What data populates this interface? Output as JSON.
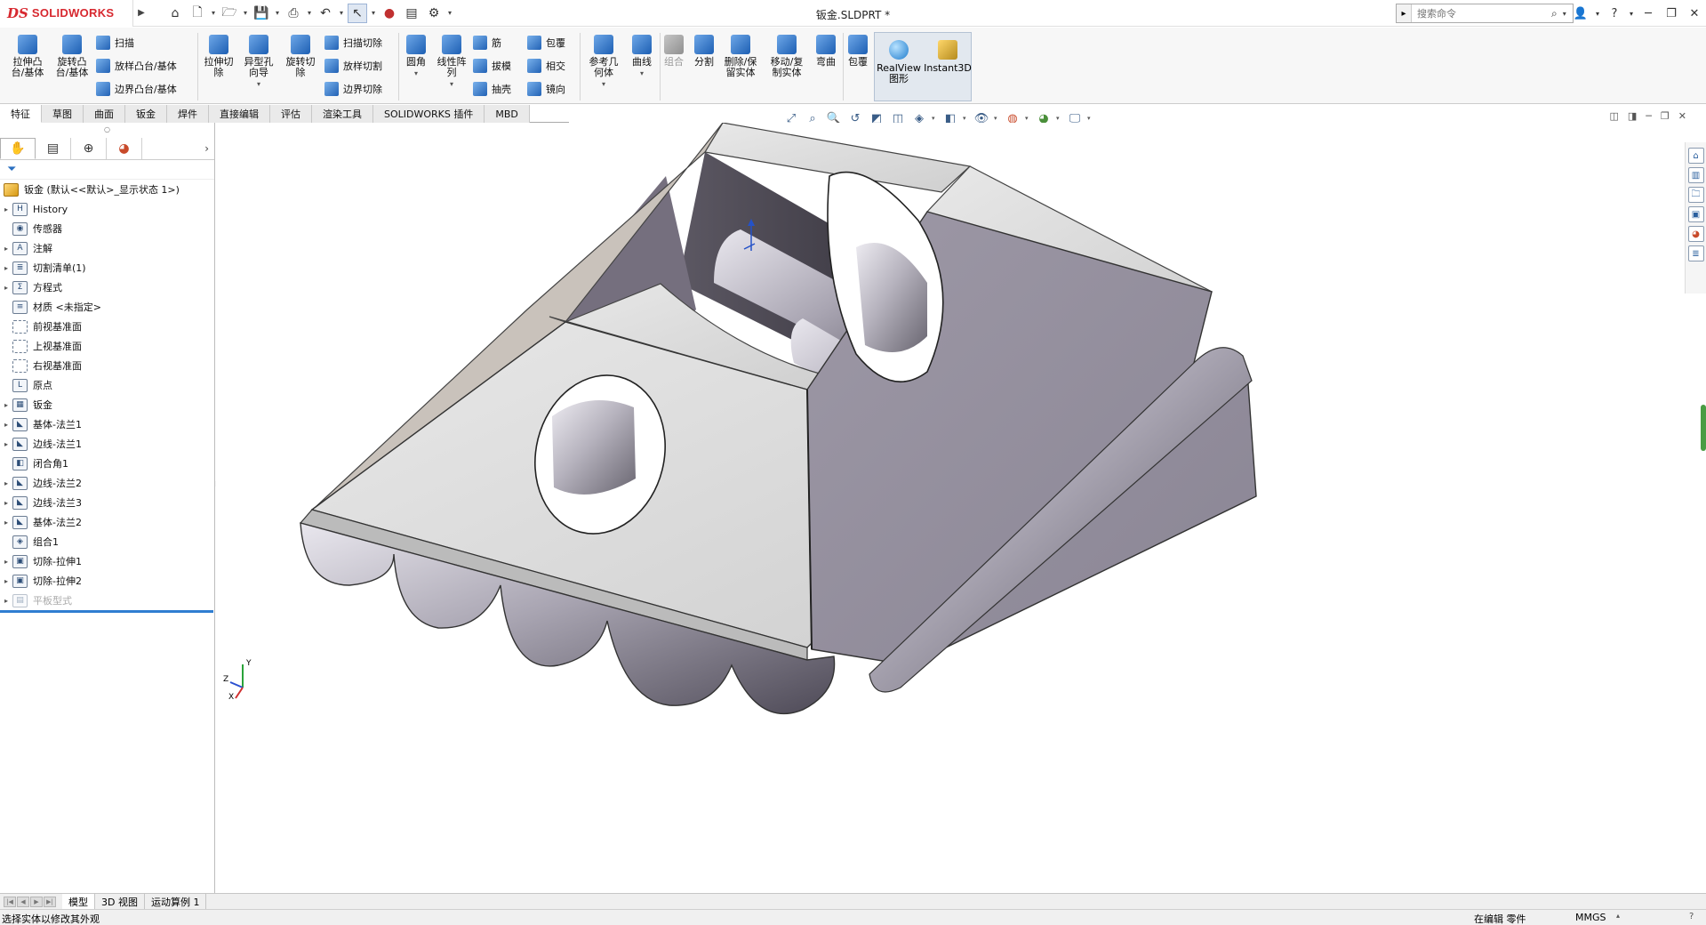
{
  "app": {
    "brand": "SOLIDWORKS",
    "brand_prefix": "DS",
    "document_title": "钣金.SLDPRT *",
    "search_placeholder": "搜索命令"
  },
  "ribbon": {
    "big_buttons": [
      {
        "label": "拉伸凸\n台/基体"
      },
      {
        "label": "旋转凸\n台/基体"
      },
      {
        "label": "拉伸切\n除"
      },
      {
        "label": "异型孔\n向导"
      },
      {
        "label": "旋转切\n除"
      },
      {
        "label": "圆角"
      },
      {
        "label": "线性阵\n列"
      },
      {
        "label": "参考几\n何体"
      },
      {
        "label": "曲线"
      },
      {
        "label": "组合"
      },
      {
        "label": "分割"
      },
      {
        "label": "删除/保\n留实体"
      },
      {
        "label": "移动/复\n制实体"
      },
      {
        "label": "弯曲"
      },
      {
        "label": "包覆"
      }
    ],
    "small_buttons": [
      {
        "label": "扫描"
      },
      {
        "label": "放样凸台/基体"
      },
      {
        "label": "边界凸台/基体"
      },
      {
        "label": "扫描切除"
      },
      {
        "label": "放样切割"
      },
      {
        "label": "边界切除"
      },
      {
        "label": "筋"
      },
      {
        "label": "拔模"
      },
      {
        "label": "抽壳"
      },
      {
        "label": "包覆"
      },
      {
        "label": "相交"
      },
      {
        "label": "镜向"
      }
    ],
    "realview": "RealView\n图形",
    "instant3d": "Instant3D"
  },
  "tabs": [
    "特征",
    "草图",
    "曲面",
    "钣金",
    "焊件",
    "直接编辑",
    "评估",
    "渲染工具",
    "SOLIDWORKS 插件",
    "MBD"
  ],
  "tree": {
    "root": "钣金  (默认<<默认>_显示状态 1>)",
    "items": [
      {
        "label": "History",
        "expandable": true,
        "icon": "H"
      },
      {
        "label": "传感器",
        "expandable": false,
        "icon": "◉"
      },
      {
        "label": "注解",
        "expandable": true,
        "icon": "A"
      },
      {
        "label": "切割清单(1)",
        "expandable": true,
        "icon": "≣"
      },
      {
        "label": "方程式",
        "expandable": true,
        "icon": "Σ"
      },
      {
        "label": "材质 <未指定>",
        "expandable": false,
        "icon": "≡"
      },
      {
        "label": "前视基准面",
        "expandable": false,
        "icon": "",
        "plane": true
      },
      {
        "label": "上视基准面",
        "expandable": false,
        "icon": "",
        "plane": true
      },
      {
        "label": "右视基准面",
        "expandable": false,
        "icon": "",
        "plane": true
      },
      {
        "label": "原点",
        "expandable": false,
        "icon": "L"
      },
      {
        "label": "钣金",
        "expandable": true,
        "icon": "▦"
      },
      {
        "label": "基体-法兰1",
        "expandable": true,
        "icon": "◣"
      },
      {
        "label": "边线-法兰1",
        "expandable": true,
        "icon": "◣"
      },
      {
        "label": "闭合角1",
        "expandable": false,
        "icon": "◧"
      },
      {
        "label": "边线-法兰2",
        "expandable": true,
        "icon": "◣"
      },
      {
        "label": "边线-法兰3",
        "expandable": true,
        "icon": "◣"
      },
      {
        "label": "基体-法兰2",
        "expandable": true,
        "icon": "◣"
      },
      {
        "label": "组合1",
        "expandable": false,
        "icon": "◈"
      },
      {
        "label": "切除-拉伸1",
        "expandable": true,
        "icon": "▣"
      },
      {
        "label": "切除-拉伸2",
        "expandable": true,
        "icon": "▣"
      },
      {
        "label": "平板型式",
        "expandable": true,
        "icon": "▤",
        "dim": true
      }
    ]
  },
  "bottom_tabs": [
    "模型",
    "3D 视图",
    "运动算例 1"
  ],
  "status": {
    "message": "选择实体以修改其外观",
    "edit_state": "在编辑 零件",
    "units": "MMGS"
  },
  "triad": {
    "x": "X",
    "y": "Y",
    "z": "Z"
  },
  "colors": {
    "accent": "#2f7dd1",
    "brand": "#d7282f",
    "metal": "#b9b6be",
    "metal_dark": "#7b7785"
  }
}
